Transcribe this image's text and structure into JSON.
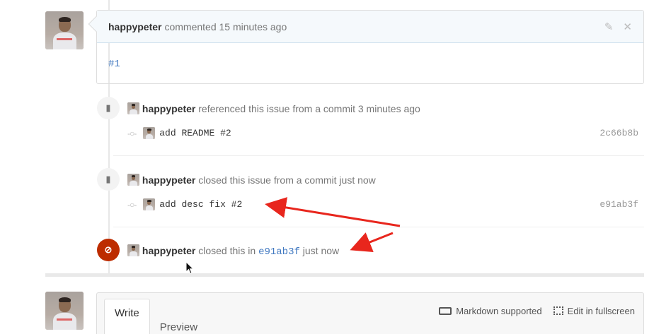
{
  "comment": {
    "author": "happypeter",
    "meta": "commented 15 minutes ago",
    "body_link": "#1"
  },
  "events": [
    {
      "author": "happypeter",
      "text": "referenced this issue from a commit 3 minutes ago",
      "commit_message": "add README #2",
      "commit_sha": "2c66b8b"
    },
    {
      "author": "happypeter",
      "text": "closed this issue from a commit just now",
      "commit_message": "add desc fix #2",
      "commit_sha": "e91ab3f"
    },
    {
      "author": "happypeter",
      "text_before": "closed this in",
      "sha_link": "e91ab3f",
      "text_after": "just now"
    }
  ],
  "new_comment": {
    "tab_write": "Write",
    "tab_preview": "Preview",
    "markdown_label": "Markdown supported",
    "fullscreen_label": "Edit in fullscreen"
  },
  "colors": {
    "closed_badge": "#bd2c00",
    "link": "#4078c0",
    "annotation_arrow": "#e8261d"
  },
  "icons": {
    "edit": "pencil-icon",
    "delete": "close-icon",
    "bookmark": "bookmark-icon",
    "commit": "git-commit-icon",
    "closed": "circle-slash-icon",
    "markdown": "markdown-icon",
    "fullscreen": "fullscreen-icon"
  }
}
